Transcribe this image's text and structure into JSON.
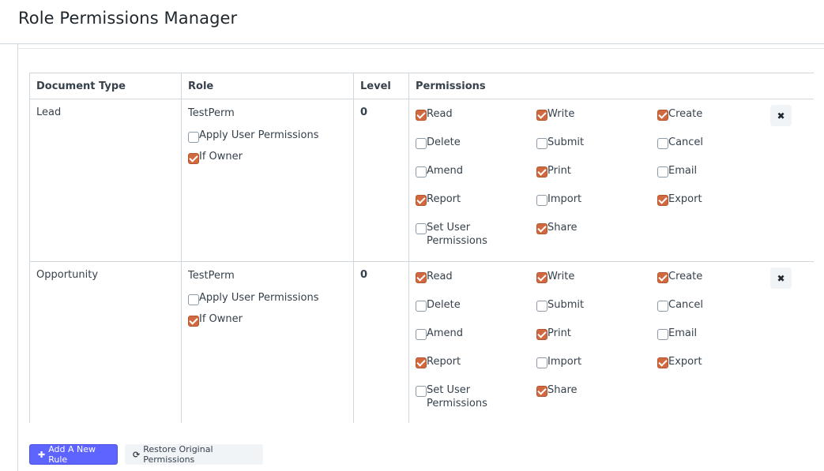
{
  "page": {
    "title": "Role Permissions Manager"
  },
  "table": {
    "headers": {
      "document_type": "Document Type",
      "role": "Role",
      "level": "Level",
      "permissions": "Permissions"
    },
    "rows": [
      {
        "document_type": "Lead",
        "role": "TestPerm",
        "apply_user_permissions": {
          "label": "Apply User Permissions",
          "checked": false
        },
        "if_owner": {
          "label": "If Owner",
          "checked": true
        },
        "level": "0",
        "permissions": [
          {
            "label": "Read",
            "checked": true
          },
          {
            "label": "Write",
            "checked": true
          },
          {
            "label": "Create",
            "checked": true
          },
          {
            "label": "Delete",
            "checked": false
          },
          {
            "label": "Submit",
            "checked": false
          },
          {
            "label": "Cancel",
            "checked": false
          },
          {
            "label": "Amend",
            "checked": false
          },
          {
            "label": "Print",
            "checked": true
          },
          {
            "label": "Email",
            "checked": false
          },
          {
            "label": "Report",
            "checked": true
          },
          {
            "label": "Import",
            "checked": false
          },
          {
            "label": "Export",
            "checked": true
          },
          {
            "label": "Set User Permissions",
            "checked": false
          },
          {
            "label": "Share",
            "checked": true
          }
        ],
        "remove_icon": "close-icon"
      },
      {
        "document_type": "Opportunity",
        "role": "TestPerm",
        "apply_user_permissions": {
          "label": "Apply User Permissions",
          "checked": false
        },
        "if_owner": {
          "label": "If Owner",
          "checked": true
        },
        "level": "0",
        "permissions": [
          {
            "label": "Read",
            "checked": true
          },
          {
            "label": "Write",
            "checked": true
          },
          {
            "label": "Create",
            "checked": true
          },
          {
            "label": "Delete",
            "checked": false
          },
          {
            "label": "Submit",
            "checked": false
          },
          {
            "label": "Cancel",
            "checked": false
          },
          {
            "label": "Amend",
            "checked": false
          },
          {
            "label": "Print",
            "checked": true
          },
          {
            "label": "Email",
            "checked": false
          },
          {
            "label": "Report",
            "checked": true
          },
          {
            "label": "Import",
            "checked": false
          },
          {
            "label": "Export",
            "checked": true
          },
          {
            "label": "Set User Permissions",
            "checked": false
          },
          {
            "label": "Share",
            "checked": true
          }
        ],
        "remove_icon": "close-icon"
      }
    ]
  },
  "actions": {
    "add_rule": {
      "label": "Add A New Rule",
      "icon": "plus-icon"
    },
    "restore": {
      "label": "Restore Original Permissions",
      "icon": "refresh-icon"
    }
  },
  "colors": {
    "checked": "#d0693f",
    "primary": "#5e64ff"
  }
}
